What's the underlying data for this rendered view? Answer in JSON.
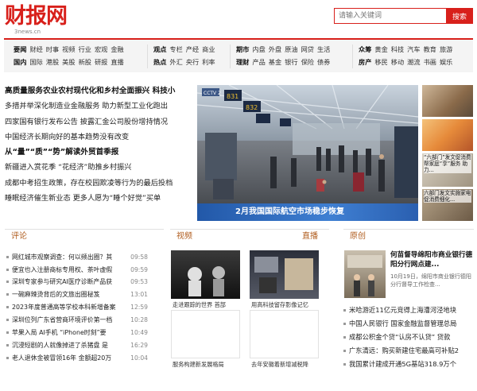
{
  "site": {
    "logo_text": "财报网",
    "logo_url": "3news.cn",
    "search_placeholder": "请输入关键词",
    "search_button": "搜索"
  },
  "nav": {
    "g1": [
      [
        "要闻",
        "财经",
        "时事",
        "视频",
        "行业",
        "宏观",
        "金融"
      ],
      [
        "国内",
        "国际",
        "港股",
        "美股",
        "新股",
        "研报",
        "直播"
      ]
    ],
    "g2": [
      [
        "观点",
        "专栏",
        "产经",
        "商业"
      ],
      [
        "热点",
        "外汇",
        "央行",
        "利率"
      ]
    ],
    "g3": [
      [
        "期市",
        "内盘",
        "外盘",
        "原油",
        "网贷",
        "生活"
      ],
      [
        "理财",
        "产品",
        "基金",
        "银行",
        "保险",
        "债券"
      ]
    ],
    "g4": [
      [
        "众筹",
        "黄金",
        "科技",
        "汽车",
        "教育",
        "旅游"
      ],
      [
        "房产",
        "移民",
        "移动",
        "潮流",
        "书画",
        "娱乐"
      ]
    ]
  },
  "headlines": [
    {
      "text": "高质量服务农业农村现代化和乡村全面振兴 科技小",
      "bold": true
    },
    {
      "text": "多措并举深化制造业金融服务 助力新型工业化跑出",
      "bold": false
    },
    {
      "text": "四家国有银行发布公告 披露汇金公司股份增持情况",
      "bold": false
    },
    {
      "text": "中国经济长期向好的基本趋势没有改变",
      "bold": false
    },
    {
      "text": "从“量”“质”“势”解读外贸首季报",
      "bold": true
    },
    {
      "text": "新疆进入赏花季 “花经济”助推乡村振兴",
      "bold": false
    },
    {
      "text": "成都中考招生政策，存在校园欺凌等行为的最后投档",
      "bold": false
    },
    {
      "text": "睡眠经济催生新业态 更多人愿为“睡个好觉”买单",
      "bold": false
    }
  ],
  "hero": {
    "caption": "2月我国国际航空市场稳步恢复",
    "gate_numbers": [
      "831",
      "832"
    ],
    "cctv": "CCTV 2"
  },
  "side_items": [
    {
      "text": ""
    },
    {
      "text": "“六部门”发文促消费帮家庭“享”服务 助力..."
    },
    {
      "text": "六部门发文实施家电 促消费细化..."
    }
  ],
  "sections": {
    "comment": "评论",
    "video": "视频",
    "live": "直播",
    "original": "原创"
  },
  "comments": [
    {
      "text": "网红城市观察调查：何以频出圈？其",
      "time": "09:58"
    },
    {
      "text": "便宜也入注册商标专用权、茶叶虚假",
      "time": "09:59"
    },
    {
      "text": "深圳专家参与研究AI医疗诊断产品获",
      "time": "09:53"
    },
    {
      "text": "一碗麻辣烫背后的文旅出圈秘笈",
      "time": "13:01"
    },
    {
      "text": "2023年度普通高等学校本科新增备案",
      "time": "12:59"
    },
    {
      "text": "深圳位列广东省营商环境评价第一档",
      "time": "10:28"
    },
    {
      "text": "苹果入局 AI手机 “iPhone时刻”要",
      "time": "10:49"
    },
    {
      "text": "沉浸短剧的人就像掉进了杀猪盘 是",
      "time": "16:29"
    },
    {
      "text": "老人退休金被冒领16年 金额超20万",
      "time": "10:04"
    }
  ],
  "videos": [
    {
      "caption": "走进跟踪的世界 首部"
    },
    {
      "caption": "用高科技留存影像记忆"
    },
    {
      "caption": "服务构建新发展格局"
    },
    {
      "caption": "去年安徽着新增减税降"
    }
  ],
  "original": {
    "title": "何苗督导绵阳市商业银行德阳分行网点建...",
    "summary": "10月19日，绵阳市商业银行德阳分行督导工作检查...",
    "list": [
      "米哈游近11亿元竞得上海漕河泾地块",
      "中国人民银行 国家金融监督管理总局",
      "成都公积金个贷“认房不认贷” 贷款",
      "广东清远：购买新建住宅最高可补贴2",
      "我国累计建成开通5G基站318.9万个"
    ]
  },
  "colors": {
    "brand": "#d8201b",
    "section": "#b05c1e"
  }
}
